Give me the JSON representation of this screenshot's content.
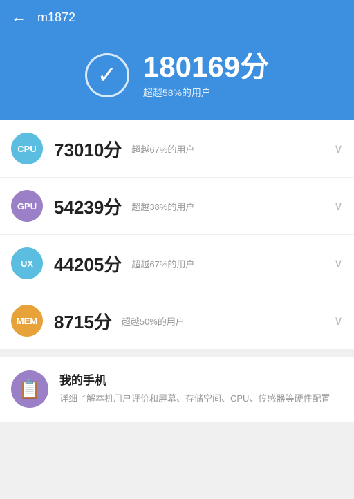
{
  "header": {
    "back_label": "←",
    "title": "m1872"
  },
  "banner": {
    "score": "180169分",
    "subtitle": "超越58%的用户"
  },
  "categories": [
    {
      "id": "cpu",
      "label": "CPU",
      "score": "73010分",
      "percent": "超越67%的用户",
      "badge_class": "badge-cpu"
    },
    {
      "id": "gpu",
      "label": "GPU",
      "score": "54239分",
      "percent": "超越38%的用户",
      "badge_class": "badge-gpu"
    },
    {
      "id": "ux",
      "label": "UX",
      "score": "44205分",
      "percent": "超越67%的用户",
      "badge_class": "badge-ux"
    },
    {
      "id": "mem",
      "label": "MEM",
      "score": "8715分",
      "percent": "超越50%的用户",
      "badge_class": "badge-mem"
    }
  ],
  "myphone": {
    "title": "我的手机",
    "description": "详细了解本机用户评价和屏幕、存储空间、CPU、传感器等硬件配置"
  }
}
